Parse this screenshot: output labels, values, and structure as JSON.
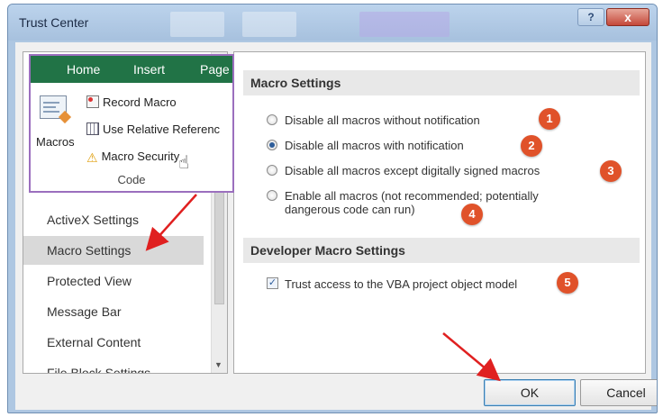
{
  "window": {
    "title": "Trust Center",
    "help_label": "?",
    "close_label": "x"
  },
  "ribbon": {
    "tabs": [
      "Home",
      "Insert",
      "Page"
    ],
    "macros_label": "Macros",
    "record_macro": "Record Macro",
    "use_relative": "Use Relative Referenc",
    "macro_security": "Macro Security",
    "group_label": "Code"
  },
  "nav": {
    "items": [
      "ActiveX Settings",
      "Macro Settings",
      "Protected View",
      "Message Bar",
      "External Content",
      "File Block Settings"
    ],
    "selected": "Macro Settings"
  },
  "macro_settings": {
    "heading": "Macro Settings",
    "options": [
      {
        "label": "Disable all macros without notification",
        "checked": false,
        "badge": "1"
      },
      {
        "label": "Disable all macros with notification",
        "checked": true,
        "badge": "2"
      },
      {
        "label": "Disable all macros except digitally signed macros",
        "checked": false,
        "badge": "3"
      },
      {
        "label": "Enable all macros (not recommended; potentially",
        "label_line2": "dangerous code can run)",
        "checked": false,
        "badge": "4"
      }
    ]
  },
  "developer_settings": {
    "heading": "Developer Macro Settings",
    "trust_vba": {
      "label": "Trust access to the VBA project object model",
      "checked": true,
      "badge": "5"
    }
  },
  "buttons": {
    "ok": "OK",
    "cancel": "Cancel"
  },
  "colors": {
    "ribbon_green": "#217346",
    "badge_orange": "#e0522a",
    "arrow_red": "#e02020",
    "highlight_purple": "#9b6fbe"
  }
}
